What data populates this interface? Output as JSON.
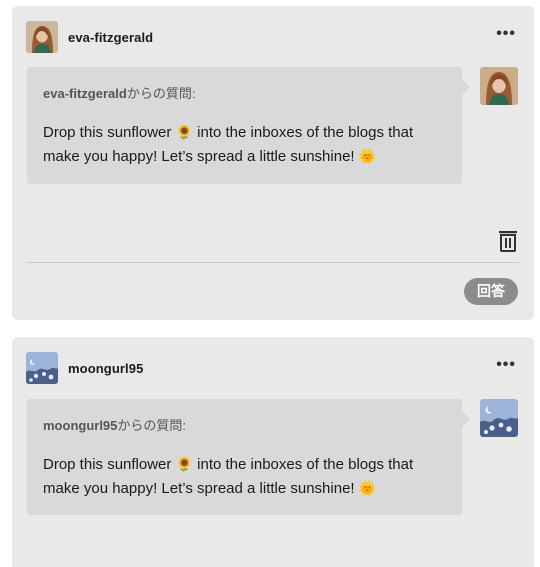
{
  "posts": [
    {
      "blog_name": "eva-fitzgerald",
      "asker": "eva-fitzgerald",
      "asker_suffix": "からの質問:",
      "question_part1": "Drop this sunflower ",
      "sunflower": "🌻",
      "question_part2": " into the inboxes of the blogs that make you happy! Let’s spread a little sunshine! ",
      "sun": "🌞",
      "more_label": "•••",
      "answer_label": "回答",
      "avatar_icon": "woman-portrait-avatar-icon"
    },
    {
      "blog_name": "moongurl95",
      "asker": "moongurl95",
      "asker_suffix": "からの質問:",
      "question_part1": "Drop this sunflower ",
      "sunflower": "🌻",
      "question_part2": " into the inboxes of the blogs that make you happy! Let’s spread a little sunshine! ",
      "sun": "🌞",
      "more_label": "•••",
      "avatar_icon": "moon-sky-flowers-avatar-icon"
    }
  ],
  "colors": {
    "card_bg": "#e9e9e9",
    "bubble_bg": "#d9d9d9",
    "button_bg": "#8c8c8c"
  }
}
